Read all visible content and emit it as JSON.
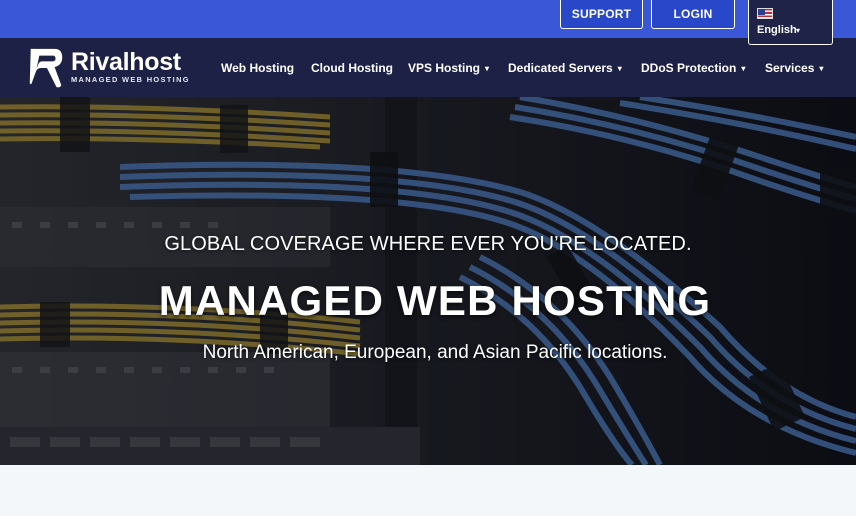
{
  "topbar": {
    "support_label": "SUPPORT",
    "login_label": "LOGIN",
    "language": {
      "label": "English",
      "flag_icon": "us-flag-icon",
      "caret": "▾"
    }
  },
  "brand": {
    "name": "Rivalhost",
    "tagline": "MANAGED WEB HOSTING",
    "logo_icon": "rivalhost-logo-icon"
  },
  "nav": {
    "dropdown_glyph": "▾",
    "items": [
      {
        "label": "Web Hosting",
        "dropdown": false
      },
      {
        "label": "Cloud Hosting",
        "dropdown": false
      },
      {
        "label": "VPS Hosting",
        "dropdown": true
      },
      {
        "label": "Dedicated Servers",
        "dropdown": true
      },
      {
        "label": "DDoS Protection",
        "dropdown": true
      },
      {
        "label": "Services",
        "dropdown": true
      }
    ]
  },
  "hero": {
    "subtitle": "GLOBAL COVERAGE WHERE EVER YOU’RE LOCATED.",
    "title": "MANAGED WEB HOSTING",
    "description": "North American, European, and Asian Pacific locations."
  },
  "colors": {
    "topbar": "#3a57d8",
    "navbar": "#1d2145",
    "cable_yellow": "#c9a93a",
    "cable_blue": "#5b8fd6",
    "page_bg": "#f4f7fa"
  }
}
